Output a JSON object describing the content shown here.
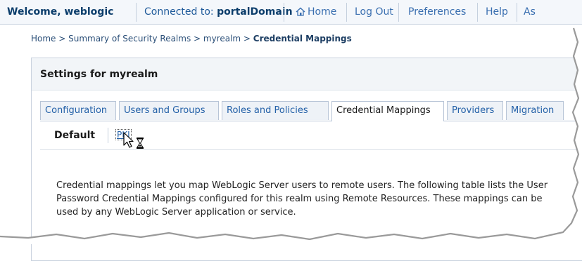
{
  "topbar": {
    "welcome_label": "Welcome, weblogic",
    "connected_label": "Connected to:",
    "connected_domain": "portalDomain",
    "links": [
      "Home",
      "Log Out",
      "Preferences",
      "Help",
      "As"
    ]
  },
  "breadcrumb": {
    "path": "Home > Summary of Security Realms > myrealm > ",
    "current": "Credential Mappings"
  },
  "panel": {
    "title": "Settings for myrealm"
  },
  "tabs": [
    {
      "label": "Configuration",
      "active": false
    },
    {
      "label": "Users and Groups",
      "active": false
    },
    {
      "label": "Roles and Policies",
      "active": false
    },
    {
      "label": "Credential Mappings",
      "active": true
    },
    {
      "label": "Providers",
      "active": false
    },
    {
      "label": "Migration",
      "active": false
    }
  ],
  "subtabs": {
    "default_label": "Default",
    "pki_label": "PKI"
  },
  "description": "Credential mappings let you map WebLogic Server users to remote users. The following table lists the User Password Credential Mappings configured for this realm using Remote Resources. These mappings can be used by any WebLogic Server application or service.",
  "icons": {
    "home": "home-icon",
    "cursor": "busy-cursor-icon"
  }
}
